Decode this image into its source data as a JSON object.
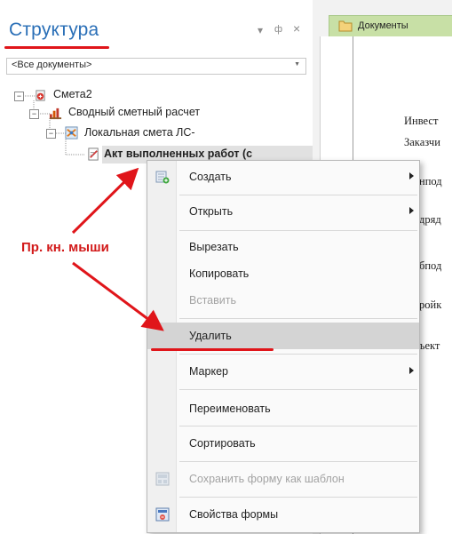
{
  "panel": {
    "title": "Структура",
    "controls": {
      "dropdown": "▾",
      "pin": "ф",
      "close": "×"
    },
    "filter": {
      "value": "<Все документы>"
    }
  },
  "tree": [
    {
      "label": "Смета2",
      "level": 0,
      "expander": "−",
      "icon": "estimate-icon"
    },
    {
      "label": "Сводный сметный расчет",
      "level": 1,
      "expander": "−",
      "icon": "summary-estimate-icon"
    },
    {
      "label": "Локальная смета ЛС-",
      "level": 2,
      "expander": "−",
      "icon": "local-estimate-icon"
    },
    {
      "label": "Акт выполненных работ (с",
      "level": 3,
      "expander": "",
      "icon": "act-icon",
      "selected": true
    }
  ],
  "document": {
    "tab_label": "Документы",
    "lines": [
      "Инвест",
      "Заказчи",
      "нпод",
      "дряд",
      "бпод",
      "ройк",
      "ъект"
    ]
  },
  "context_menu": {
    "items": [
      {
        "id": "create",
        "label": "Создать",
        "submenu": true,
        "icon": "create-icon"
      },
      {
        "id": "open",
        "label": "Открыть",
        "submenu": true
      },
      {
        "id": "cut",
        "label": "Вырезать"
      },
      {
        "id": "copy",
        "label": "Копировать"
      },
      {
        "id": "paste",
        "label": "Вставить",
        "disabled": true
      },
      {
        "id": "delete",
        "label": "Удалить",
        "highlighted": true
      },
      {
        "id": "marker",
        "label": "Маркер",
        "submenu": true
      },
      {
        "id": "rename",
        "label": "Переименовать"
      },
      {
        "id": "sort",
        "label": "Сортировать"
      },
      {
        "id": "save-template",
        "label": "Сохранить форму как шаблон",
        "disabled": true,
        "icon": "template-icon"
      },
      {
        "id": "form-props",
        "label": "Свойства формы",
        "icon": "form-properties-icon"
      }
    ]
  },
  "annotation": {
    "text": "Пр. кн. мыши",
    "color": "#d21a1a"
  },
  "colors": {
    "title_blue": "#2a6fb7",
    "tab_green": "#c8e0a6",
    "highlight": "#d4d4d4",
    "annotation_red": "#e0151a"
  }
}
